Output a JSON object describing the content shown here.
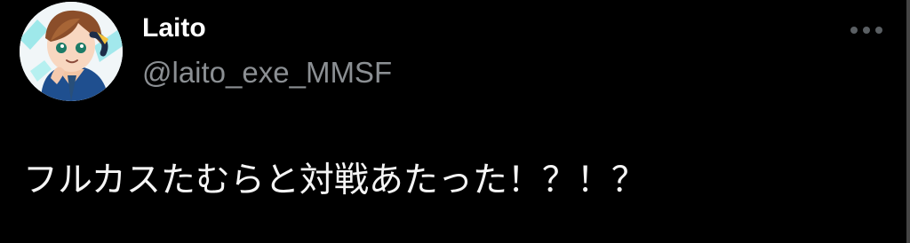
{
  "tweet": {
    "display_name": "Laito",
    "handle": "@laito_exe_MMSF",
    "text": "フルカスたむらと対戦あたった！？！？",
    "avatar_icon": "anime-boy-avatar-icon",
    "more_icon": "more-options-icon"
  },
  "colors": {
    "background": "#000000",
    "name": "#ffffff",
    "handle": "#8b8f93",
    "text": "#f5f5f5",
    "more_dots": "#5a5f63"
  }
}
